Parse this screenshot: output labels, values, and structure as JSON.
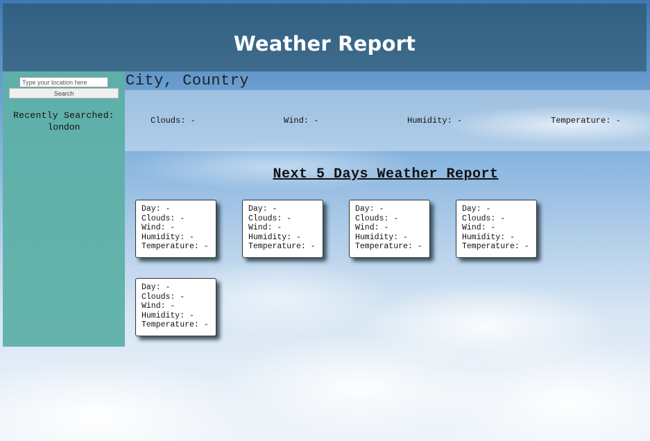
{
  "header": {
    "title": "Weather Report"
  },
  "sidebar": {
    "search_placeholder": "Type your location here",
    "search_button": "Search",
    "recent_label": "Recently Searched:",
    "recent_items": [
      "london"
    ]
  },
  "current": {
    "location": "City, Country",
    "clouds": "Clouds: -",
    "wind": "Wind: -",
    "humidity": "Humidity: -",
    "temperature": "Temperature: -"
  },
  "forecast": {
    "heading": "Next 5 Days Weather Report",
    "days": [
      {
        "day": "Day: -",
        "clouds": "Clouds: -",
        "wind": "Wind: -",
        "humidity": "Humidity: -",
        "temperature": "Temperature: -"
      },
      {
        "day": "Day: -",
        "clouds": "Clouds: -",
        "wind": "Wind: -",
        "humidity": "Humidity: -",
        "temperature": "Temperature: -"
      },
      {
        "day": "Day: -",
        "clouds": "Clouds: -",
        "wind": "Wind: -",
        "humidity": "Humidity: -",
        "temperature": "Temperature: -"
      },
      {
        "day": "Day: -",
        "clouds": "Clouds: -",
        "wind": "Wind: -",
        "humidity": "Humidity: -",
        "temperature": "Temperature: -"
      },
      {
        "day": "Day: -",
        "clouds": "Clouds: -",
        "wind": "Wind: -",
        "humidity": "Humidity: -",
        "temperature": "Temperature: -"
      }
    ]
  }
}
